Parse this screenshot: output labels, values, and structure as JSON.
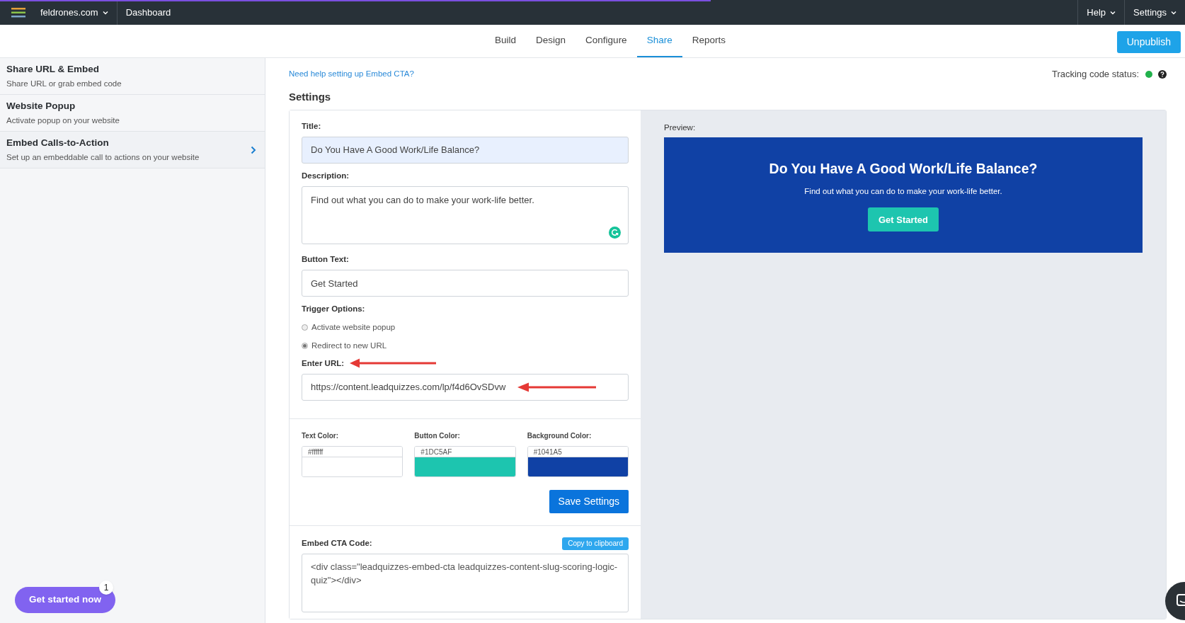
{
  "top_bar": {
    "loading_bar": {
      "level": 0.6
    },
    "site": "feldrones.com",
    "dashboard": "Dashboard",
    "menus": [
      "Help",
      "Settings"
    ]
  },
  "tabs": [
    {
      "label": "Build",
      "selected": false
    },
    {
      "label": "Design",
      "selected": false
    },
    {
      "label": "Configure",
      "selected": false
    },
    {
      "label": "Share",
      "selected": true
    },
    {
      "label": "Reports",
      "selected": false
    }
  ],
  "unpublish_button": "Unpublish",
  "sidebar": {
    "items": [
      {
        "title": "Share URL & Embed",
        "subtitle": "Share URL or grab embed code",
        "selected": false
      },
      {
        "title": "Website Popup",
        "subtitle": "Activate popup on your website",
        "selected": false
      },
      {
        "title": "Embed Calls-to-Action",
        "subtitle": "Set up an embeddable call to actions on your website",
        "selected": true
      }
    ]
  },
  "get_started_button": {
    "label": "Get started now",
    "badge": "1"
  },
  "help_link": "Need help setting up Embed CTA?",
  "tracking": {
    "label": "Tracking code status:",
    "color": "#22b14c"
  },
  "settings_heading": "Settings",
  "form": {
    "title_label": "Title:",
    "title_value": "Do You Have A Good Work/Life Balance?",
    "description_label": "Description:",
    "description_value": "Find out what you can do to make your work-life better.",
    "button_text_label": "Button Text:",
    "button_text_value": "Get Started",
    "trigger_label": "Trigger Options:",
    "trigger_options": [
      {
        "label": "Activate website popup",
        "selected": false
      },
      {
        "label": "Redirect to new URL",
        "selected": true
      }
    ],
    "url_label": "Enter URL:",
    "url_value": "https://content.leadquizzes.com/lp/f4d6OvSDvw"
  },
  "colors": [
    {
      "label": "Text Color:",
      "value": "#ffffff",
      "color": "#ffffff"
    },
    {
      "label": "Button Color:",
      "value": "#1DC5AF",
      "color": "#1dc5af"
    },
    {
      "label": "Background Color:",
      "value": "#1041A5",
      "color": "#1041a5"
    }
  ],
  "save_button": "Save Settings",
  "embed": {
    "label": "Embed CTA Code:",
    "copy_button": "Copy to clipboard",
    "code": "<div class=\"leadquizzes-embed-cta leadquizzes-content-slug-scoring-logic-quiz\"></div>"
  },
  "preview": {
    "label": "Preview:",
    "title": "Do You Have A Good Work/Life Balance?",
    "description": "Find out what you can do to make your work-life better.",
    "button": "Get Started"
  }
}
